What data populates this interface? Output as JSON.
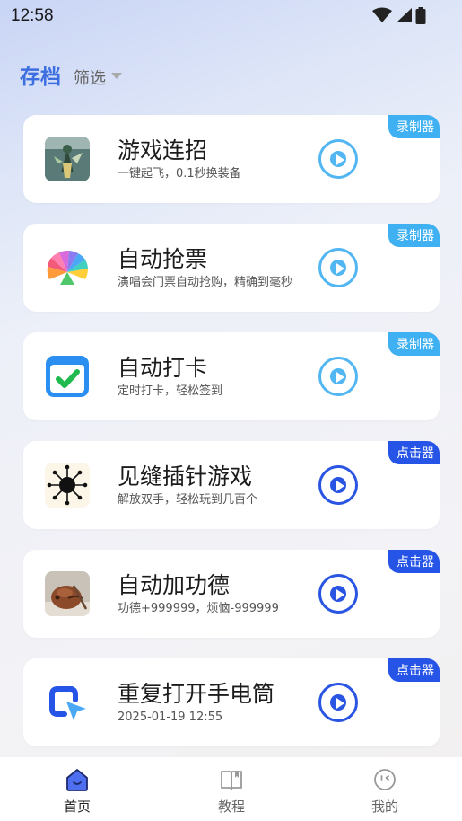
{
  "status": {
    "time": "12:58"
  },
  "header": {
    "title": "存档",
    "filter_label": "筛选"
  },
  "cards": [
    {
      "title": "游戏连招",
      "desc": "一键起飞，0.1秒换装备",
      "tag": "录制器",
      "tag_type": "recorder",
      "icon": "game-character-icon"
    },
    {
      "title": "自动抢票",
      "desc": "演唱会门票自动抢购，精确到毫秒",
      "tag": "录制器",
      "tag_type": "recorder",
      "icon": "colorful-fan-icon"
    },
    {
      "title": "自动打卡",
      "desc": "定时打卡，轻松签到",
      "tag": "录制器",
      "tag_type": "recorder",
      "icon": "calendar-check-icon"
    },
    {
      "title": "见缝插针游戏",
      "desc": "解放双手，轻松玩到几百个",
      "tag": "点击器",
      "tag_type": "clicker",
      "icon": "pin-ball-icon"
    },
    {
      "title": "自动加功德",
      "desc": "功德+999999，烦恼-999999",
      "tag": "点击器",
      "tag_type": "clicker",
      "icon": "wooden-fish-icon"
    },
    {
      "title": "重复打开手电筒",
      "desc": "2025-01-19  12:55",
      "tag": "点击器",
      "tag_type": "clicker",
      "icon": "cursor-square-icon"
    }
  ],
  "nav": [
    {
      "label": "首页",
      "icon": "home-icon",
      "active": true
    },
    {
      "label": "教程",
      "icon": "book-icon",
      "active": false
    },
    {
      "label": "我的",
      "icon": "profile-icon",
      "active": false
    }
  ],
  "colors": {
    "accent": "#3e6fe0",
    "recorder_tag": "#3fb0f2",
    "clicker_tag": "#2654e6"
  }
}
